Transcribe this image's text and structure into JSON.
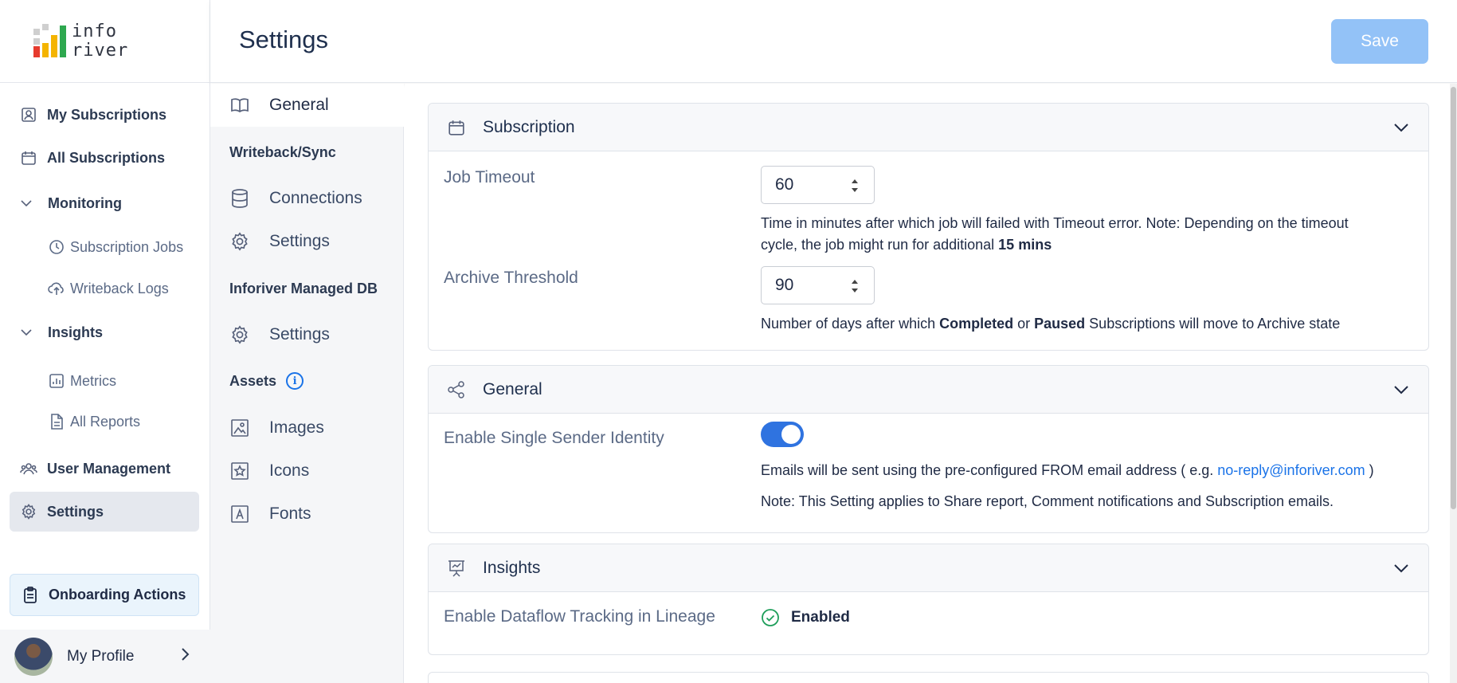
{
  "brand": {
    "logo_line1": "info",
    "logo_line2": "river"
  },
  "header": {
    "title": "Settings",
    "save_label": "Save"
  },
  "sidebar": {
    "items": [
      {
        "label": "My Subscriptions",
        "icon": "subscriptions-icon"
      },
      {
        "label": "All Subscriptions",
        "icon": "calendar-icon"
      }
    ],
    "monitoring": {
      "label": "Monitoring",
      "children": [
        {
          "label": "Subscription Jobs",
          "icon": "clock-icon"
        },
        {
          "label": "Writeback Logs",
          "icon": "cloud-upload-icon"
        }
      ]
    },
    "insights": {
      "label": "Insights",
      "children": [
        {
          "label": "Metrics",
          "icon": "bar-chart-icon"
        },
        {
          "label": "All Reports",
          "icon": "document-icon"
        }
      ]
    },
    "user_management": "User Management",
    "settings": "Settings",
    "onboarding": "Onboarding Actions",
    "profile": "My Profile"
  },
  "subnav": {
    "general": "General",
    "writeback_heading": "Writeback/Sync",
    "connections": "Connections",
    "wb_settings": "Settings",
    "managed_db_heading": "Inforiver Managed DB",
    "db_settings": "Settings",
    "assets_heading": "Assets",
    "images": "Images",
    "icons": "Icons",
    "fonts": "Fonts"
  },
  "subscription": {
    "title": "Subscription",
    "job_timeout_label": "Job Timeout",
    "job_timeout_value": "60",
    "job_timeout_help_a": "Time in minutes after which job will failed with Timeout error. Note: Depending on the timeout",
    "job_timeout_help_b": "cycle, the job might run for additional ",
    "job_timeout_help_bold": "15 mins",
    "archive_label": "Archive Threshold",
    "archive_value": "90",
    "archive_help_a": "Number of days after which ",
    "archive_help_completed": "Completed",
    "archive_help_or": " or ",
    "archive_help_paused": "Paused",
    "archive_help_b": " Subscriptions will move to Archive state"
  },
  "general": {
    "title": "General",
    "single_sender_label": "Enable Single Sender Identity",
    "single_sender_enabled": true,
    "help_a": "Emails will be sent using the pre-configured FROM email address ( e.g. ",
    "help_email": "no-reply@inforiver.com",
    "help_b": " )",
    "note": "Note: This Setting applies to Share report, Comment notifications and Subscription emails."
  },
  "insights": {
    "title": "Insights",
    "dataflow_label": "Enable Dataflow Tracking in Lineage",
    "dataflow_status": "Enabled"
  },
  "colors": {
    "accent": "#2f73e0",
    "save_disabled": "#93c2f7",
    "link": "#1a73e8",
    "success": "#1e9e5a"
  }
}
